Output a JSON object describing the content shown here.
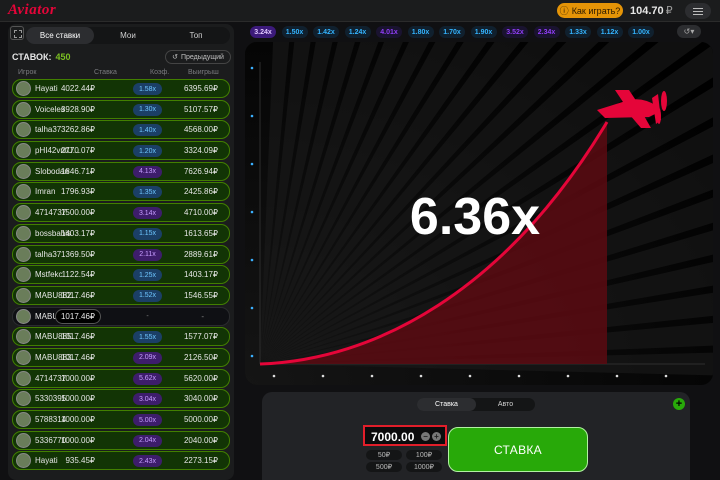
{
  "header": {
    "logo": "Aviator",
    "how_to_play": "Как играть?",
    "balance": "104.70",
    "currency": "₽"
  },
  "left_panel": {
    "tabs": [
      "Все ставки",
      "Мои",
      "Топ"
    ],
    "bets_label": "СТАВОК:",
    "bets_count": "450",
    "previous_label": "Предыдущий",
    "columns": [
      "Игрок",
      "Ставка",
      "Коэф.",
      "Выигрыш"
    ],
    "rows": [
      {
        "user": "Hayati",
        "bet": "4022.44₽",
        "coef": "1.58x",
        "coef_color": "blue",
        "win": "6395.69₽",
        "state": "won"
      },
      {
        "user": "Voiceles",
        "bet": "3928.90₽",
        "coef": "1.30x",
        "coef_color": "blue",
        "win": "5107.57₽",
        "state": "won"
      },
      {
        "user": "talha37",
        "bet": "3262.86₽",
        "coef": "1.40x",
        "coef_color": "blue",
        "win": "4568.00₽",
        "state": "won"
      },
      {
        "user": "pHI42vntU...",
        "bet": "2770.07₽",
        "coef": "1.20x",
        "coef_color": "blue",
        "win": "3324.09₽",
        "state": "won"
      },
      {
        "user": "Slobodan",
        "bet": "1846.71₽",
        "coef": "4.13x",
        "coef_color": "purple",
        "win": "7626.94₽",
        "state": "won"
      },
      {
        "user": "Imran",
        "bet": "1796.93₽",
        "coef": "1.35x",
        "coef_color": "blue",
        "win": "2425.86₽",
        "state": "won"
      },
      {
        "user": "4714737",
        "bet": "1500.00₽",
        "coef": "3.14x",
        "coef_color": "purple",
        "win": "4710.00₽",
        "state": "won"
      },
      {
        "user": "bossbahis",
        "bet": "1403.17₽",
        "coef": "1.15x",
        "coef_color": "blue",
        "win": "1613.65₽",
        "state": "won"
      },
      {
        "user": "talha37",
        "bet": "1369.50₽",
        "coef": "2.11x",
        "coef_color": "purple",
        "win": "2889.61₽",
        "state": "won"
      },
      {
        "user": "Mstfekc",
        "bet": "1122.54₽",
        "coef": "1.25x",
        "coef_color": "blue",
        "win": "1403.17₽",
        "state": "won"
      },
      {
        "user": "MABU882...",
        "bet": "1017.46₽",
        "coef": "1.52x",
        "coef_color": "blue",
        "win": "1546.55₽",
        "state": "won"
      },
      {
        "user": "MABU882...",
        "bet": "1017.46₽",
        "coef": "-",
        "coef_color": "dash",
        "win": "-",
        "state": "active"
      },
      {
        "user": "MABU885...",
        "bet": "1017.46₽",
        "coef": "1.55x",
        "coef_color": "blue",
        "win": "1577.07₽",
        "state": "won"
      },
      {
        "user": "MABU883...",
        "bet": "1017.46₽",
        "coef": "2.09x",
        "coef_color": "purple",
        "win": "2126.50₽",
        "state": "won"
      },
      {
        "user": "4714737",
        "bet": "1000.00₽",
        "coef": "5.62x",
        "coef_color": "purple",
        "win": "5620.00₽",
        "state": "won"
      },
      {
        "user": "5330395",
        "bet": "1000.00₽",
        "coef": "3.04x",
        "coef_color": "purple",
        "win": "3040.00₽",
        "state": "won"
      },
      {
        "user": "5788314",
        "bet": "1000.00₽",
        "coef": "5.00x",
        "coef_color": "purple",
        "win": "5000.00₽",
        "state": "won"
      },
      {
        "user": "5336770",
        "bet": "1000.00₽",
        "coef": "2.04x",
        "coef_color": "purple",
        "win": "2040.00₽",
        "state": "won"
      },
      {
        "user": "Hayati",
        "bet": "935.45₽",
        "coef": "2.43x",
        "coef_color": "purple",
        "win": "2273.15₽",
        "state": "won"
      }
    ]
  },
  "history": [
    {
      "value": "3.24x",
      "color": "purple"
    },
    {
      "value": "1.50x",
      "color": "blue"
    },
    {
      "value": "1.42x",
      "color": "blue"
    },
    {
      "value": "1.24x",
      "color": "blue"
    },
    {
      "value": "4.01x",
      "color": "purple"
    },
    {
      "value": "1.80x",
      "color": "blue"
    },
    {
      "value": "1.70x",
      "color": "blue"
    },
    {
      "value": "1.90x",
      "color": "blue"
    },
    {
      "value": "3.52x",
      "color": "purple"
    },
    {
      "value": "2.34x",
      "color": "purple"
    },
    {
      "value": "1.33x",
      "color": "blue"
    },
    {
      "value": "1.12x",
      "color": "blue"
    },
    {
      "value": "1.00x",
      "color": "blue"
    }
  ],
  "game": {
    "multiplier": "6.36x",
    "colors": {
      "curve": "#e50539",
      "plane": "#e50539",
      "fill": "#5c0a12"
    }
  },
  "bet_panel": {
    "tabs": [
      "Ставка",
      "Авто"
    ],
    "amount": "7000.00",
    "quick_amounts": [
      "50₽",
      "100₽",
      "500₽",
      "1000₽"
    ],
    "bet_button": "СТАВКА",
    "add_icon": "+"
  }
}
